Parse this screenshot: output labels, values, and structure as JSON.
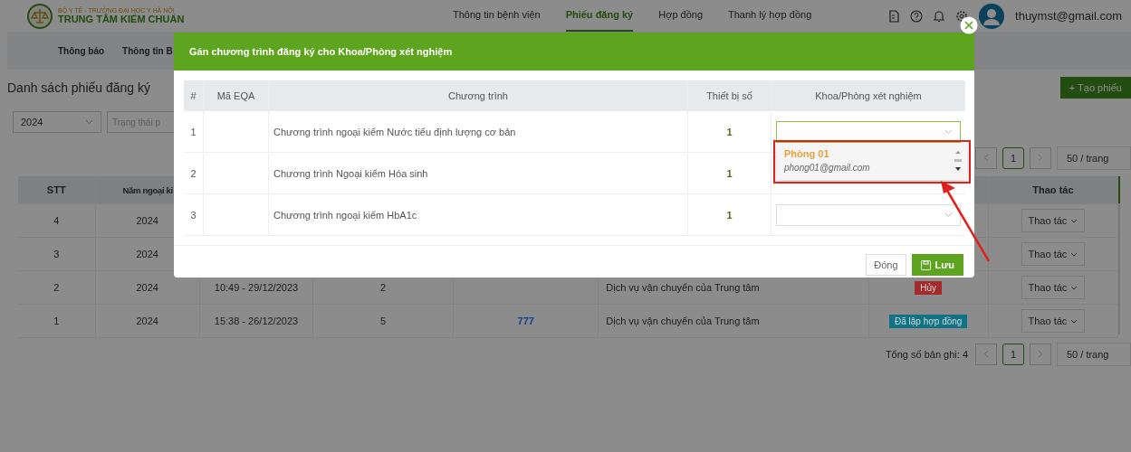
{
  "header": {
    "logo_subtitle": "BỘ Y TẾ - TRƯỜNG ĐẠI HỌC Y HÀ NỘI",
    "logo_title": "TRUNG TÂM KIỂM CHUẨN",
    "nav": [
      {
        "label": "Thông tin bệnh viện",
        "selected": false
      },
      {
        "label": "Phiếu đăng ký",
        "selected": true
      },
      {
        "label": "Hợp đồng",
        "selected": false
      },
      {
        "label": "Thanh lý hợp đồng",
        "selected": false
      }
    ],
    "user": "thuymst@gmail.com"
  },
  "subnav": [
    {
      "label": "Thông báo"
    },
    {
      "label": "Thông tin B"
    }
  ],
  "page_title": "Danh sách phiếu đăng ký",
  "create_button": "+ Tạo phiếu",
  "filters": {
    "year": "2024",
    "status_placeholder": "Trạng thái p"
  },
  "pagination_top": {
    "page": "1",
    "page_size": "50 / trang"
  },
  "table": {
    "columns": {
      "stt": "STT",
      "year": "Năm ngoại ki",
      "actions": "Thao tác"
    },
    "rows": [
      {
        "stt": "4",
        "year": "2024",
        "action": "Thao tác"
      },
      {
        "stt": "3",
        "year": "2024",
        "action": "Thao tác"
      },
      {
        "stt": "2",
        "year": "2024",
        "time": "10:49 - 29/12/2023",
        "count": "2",
        "service": "Dịch vụ vận chuyển của Trung tâm",
        "status": "Hủy",
        "color": "#a32a2a",
        "action": "Thao tác"
      },
      {
        "stt": "1",
        "year": "2024",
        "time": "15:38 - 26/12/2023",
        "count": "5",
        "code": "777",
        "service": "Dịch vụ vận chuyển của Trung tâm",
        "status": "Đã lập hợp đồng",
        "color": "#0f7385",
        "action": "Thao tác"
      }
    ]
  },
  "pagination_bottom": {
    "total": "Tổng số bản ghi: 4",
    "page": "1",
    "page_size": "50 / trang"
  },
  "modal": {
    "title": "Gán chương trình đăng ký cho Khoa/Phòng xét nghiệm",
    "columns": [
      "#",
      "Mã EQA",
      "Chương trình",
      "Thiết bị số",
      "Khoa/Phòng xét nghiệm"
    ],
    "rows": [
      {
        "index": "1",
        "program": "Chương trình ngoại kiểm Nước tiểu định lượng cơ bản",
        "device": "1",
        "focused": true
      },
      {
        "index": "2",
        "program": "Chương trình Ngoại kiểm Hóa sinh",
        "device": "1",
        "focused": false
      },
      {
        "index": "3",
        "program": "Chương trình ngoại kiểm HbA1c",
        "device": "1",
        "focused": false
      }
    ],
    "dropdown_options": [
      {
        "name": "Phòng 01",
        "email": "phong01@gmail.com"
      }
    ],
    "buttons": {
      "close": "Đóng",
      "save": "Lưu"
    }
  }
}
